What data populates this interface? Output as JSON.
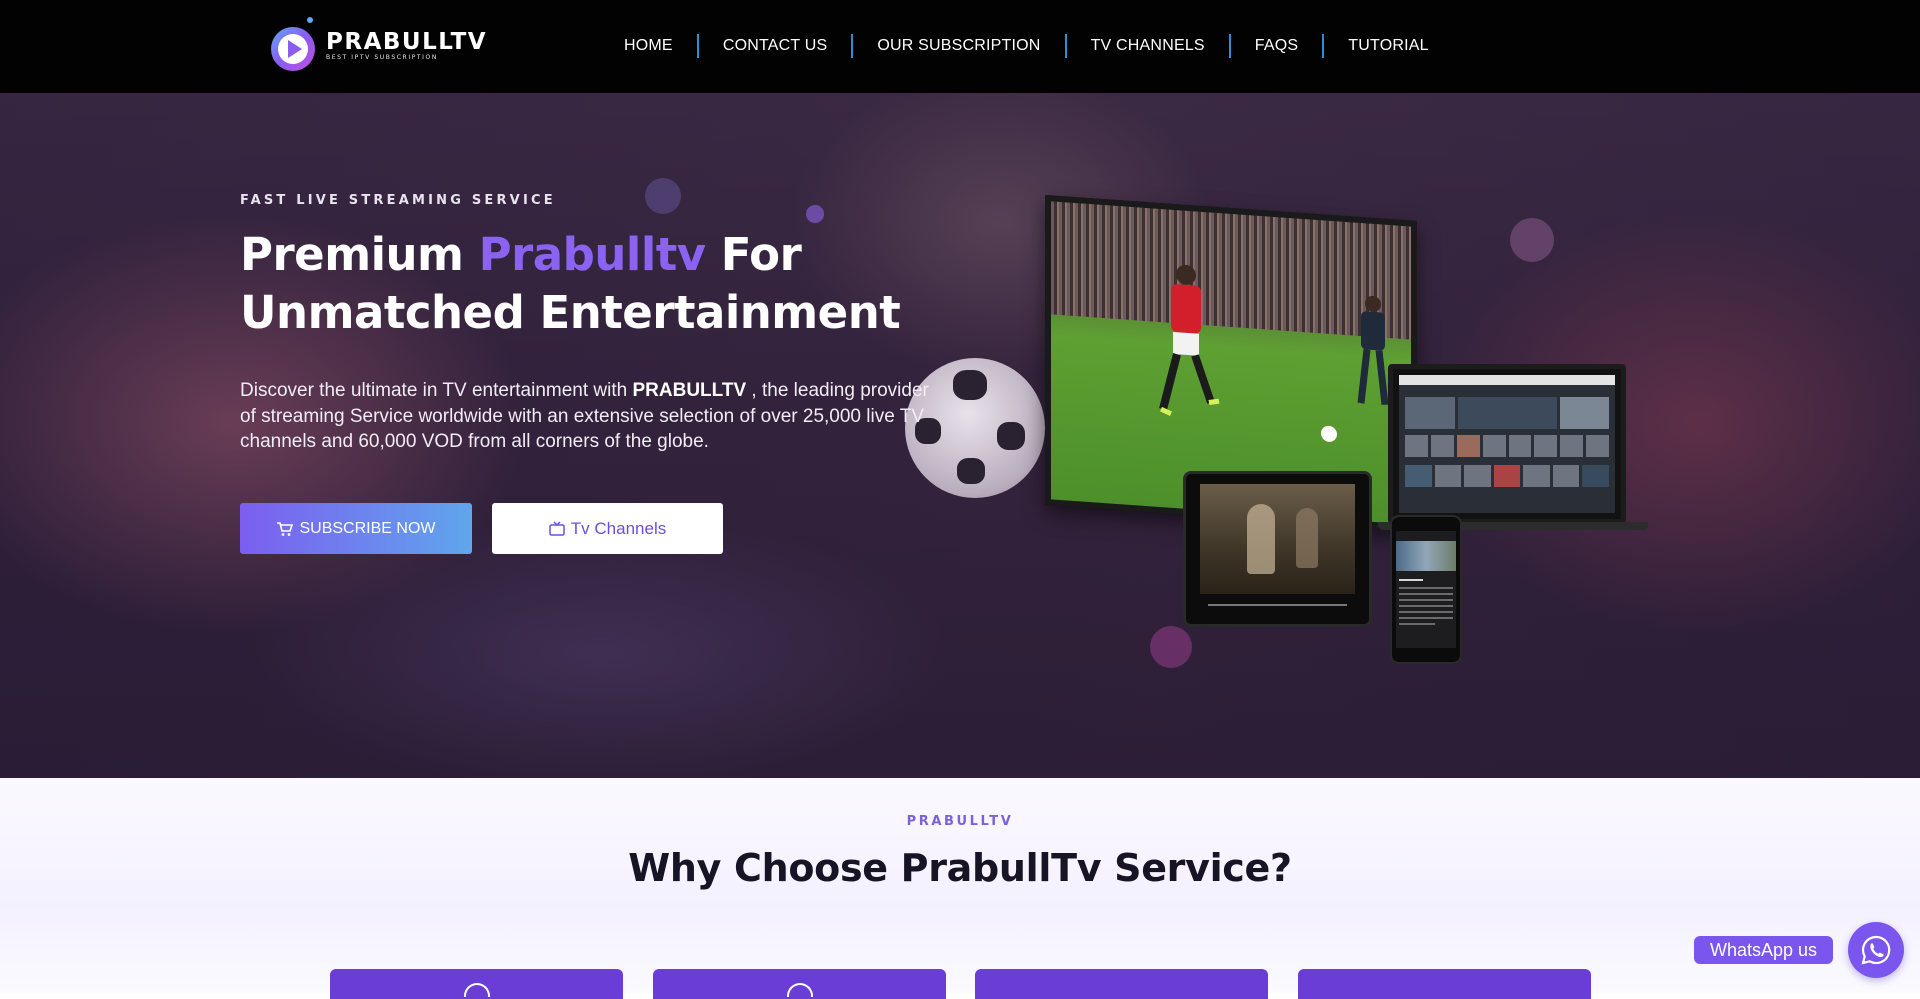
{
  "brand": {
    "name": "PRABULLTV",
    "tagline": "BEST IPTV SUBSCRIPTION"
  },
  "nav": {
    "items": [
      "HOME",
      "CONTACT US",
      "OUR SUBSCRIPTION",
      "TV CHANNELS",
      "FAQS",
      "TUTORIAL"
    ]
  },
  "hero": {
    "eyebrow": "FAST LIVE STREAMING SERVICE",
    "title_prefix": "Premium ",
    "title_accent": "Prabulltv",
    "title_suffix": " For Unmatched Entertainment",
    "desc_before": "Discover the ultimate in TV entertainment with ",
    "desc_bold": "PRABULLTV",
    "desc_after": " , the leading provider of streaming Service worldwide with an extensive selection of over 25,000 live TV channels and 60,000 VOD from all corners of the globe.",
    "subscribe_label": "SUBSCRIBE NOW",
    "channels_label": "Tv Channels"
  },
  "why": {
    "eyebrow": "PRABULLTV",
    "title": "Why Choose PrabullTv Service?"
  },
  "whatsapp": {
    "label": "WhatsApp us"
  },
  "colors": {
    "accent": "#8a63f0",
    "header_bg": "#020202",
    "nav_separator": "#2a8fd6",
    "card": "#6a3ed6",
    "whatsapp": "#7a56ee"
  },
  "icons": [
    "logo-play-icon",
    "cart-icon",
    "tv-icon",
    "whatsapp-icon"
  ]
}
